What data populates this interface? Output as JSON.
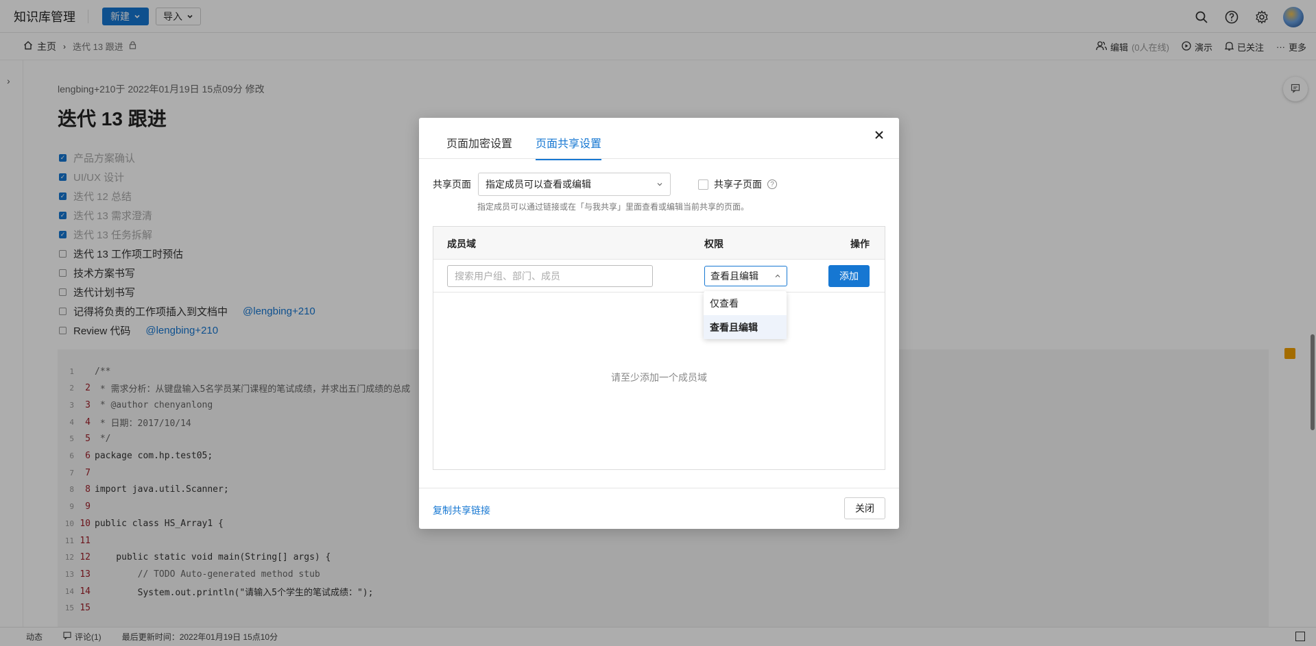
{
  "topbar": {
    "app_title": "知识库管理",
    "new_label": "新建",
    "import_label": "导入"
  },
  "breadcrumb": {
    "home": "主页",
    "current": "迭代 13 跟进",
    "actions": {
      "edit": "编辑",
      "online": "(0人在线)",
      "present": "演示",
      "followed": "已关注",
      "more": "更多"
    }
  },
  "doc": {
    "meta": "lengbing+210于 2022年01月19日 15点09分 修改",
    "title": "迭代 13 跟进",
    "tasks": [
      {
        "text": "产品方案确认",
        "done": true,
        "mention": ""
      },
      {
        "text": "UI/UX 设计",
        "done": true,
        "mention": ""
      },
      {
        "text": "迭代 12 总结",
        "done": true,
        "mention": ""
      },
      {
        "text": "迭代 13 需求澄清",
        "done": true,
        "mention": ""
      },
      {
        "text": "迭代 13 任务拆解",
        "done": true,
        "mention": ""
      },
      {
        "text": "迭代 13 工作项工时预估",
        "done": false,
        "mention": ""
      },
      {
        "text": "技术方案书写",
        "done": false,
        "mention": ""
      },
      {
        "text": "迭代计划书写",
        "done": false,
        "mention": ""
      },
      {
        "text": "记得将负责的工作项插入到文档中",
        "done": false,
        "mention": "@lengbing+210"
      },
      {
        "text": "Review 代码",
        "done": false,
        "mention": "@lengbing+210"
      }
    ],
    "code": [
      {
        "n": "1",
        "n2": "",
        "text": "/**"
      },
      {
        "n": "2",
        "n2": "2",
        "text": " * 需求分析：从键盘输入5名学员某门课程的笔试成绩，并求出五门成绩的总成"
      },
      {
        "n": "3",
        "n2": "3",
        "text": " * @author chenyanlong"
      },
      {
        "n": "4",
        "n2": "4",
        "text": " * 日期：2017/10/14"
      },
      {
        "n": "5",
        "n2": "5",
        "text": " */"
      },
      {
        "n": "6",
        "n2": "6",
        "text": "package com.hp.test05;"
      },
      {
        "n": "7",
        "n2": "7",
        "text": ""
      },
      {
        "n": "8",
        "n2": "8",
        "text": "import java.util.Scanner;"
      },
      {
        "n": "9",
        "n2": "9",
        "text": ""
      },
      {
        "n": "10",
        "n2": "10",
        "text": "public class HS_Array1 {"
      },
      {
        "n": "11",
        "n2": "11",
        "text": ""
      },
      {
        "n": "12",
        "n2": "12",
        "text": "    public static void main(String[] args) {"
      },
      {
        "n": "13",
        "n2": "13",
        "text": "        // TODO Auto-generated method stub"
      },
      {
        "n": "14",
        "n2": "14",
        "text": "        System.out.println(\"请输入5个学生的笔试成绩：\");"
      },
      {
        "n": "15",
        "n2": "15",
        "text": ""
      }
    ]
  },
  "statusbar": {
    "activity": "动态",
    "comments": "评论(1)",
    "last_updated": "最后更新时间：2022年01月19日 15点10分"
  },
  "modal": {
    "tabs": [
      "页面加密设置",
      "页面共享设置"
    ],
    "active_tab": 1,
    "share_label": "共享页面",
    "share_value": "指定成员可以查看或编辑",
    "share_sub_label": "共享子页面",
    "share_sub_checked": false,
    "hint": "指定成员可以通过链接或在「与我共享」里面查看或编辑当前共享的页面。",
    "table": {
      "col_member": "成员域",
      "col_perm": "权限",
      "col_action": "操作",
      "search_placeholder": "搜索用户组、部门、成员",
      "perm_value": "查看且编辑",
      "add_label": "添加",
      "empty": "请至少添加一个成员域"
    },
    "perm_options": [
      "仅查看",
      "查看且编辑"
    ],
    "perm_selected": 1,
    "copy_link": "复制共享链接",
    "close_label": "关闭"
  },
  "colors": {
    "accent": "#1677d2",
    "overlay": "rgba(0,0,0,0.32)"
  }
}
